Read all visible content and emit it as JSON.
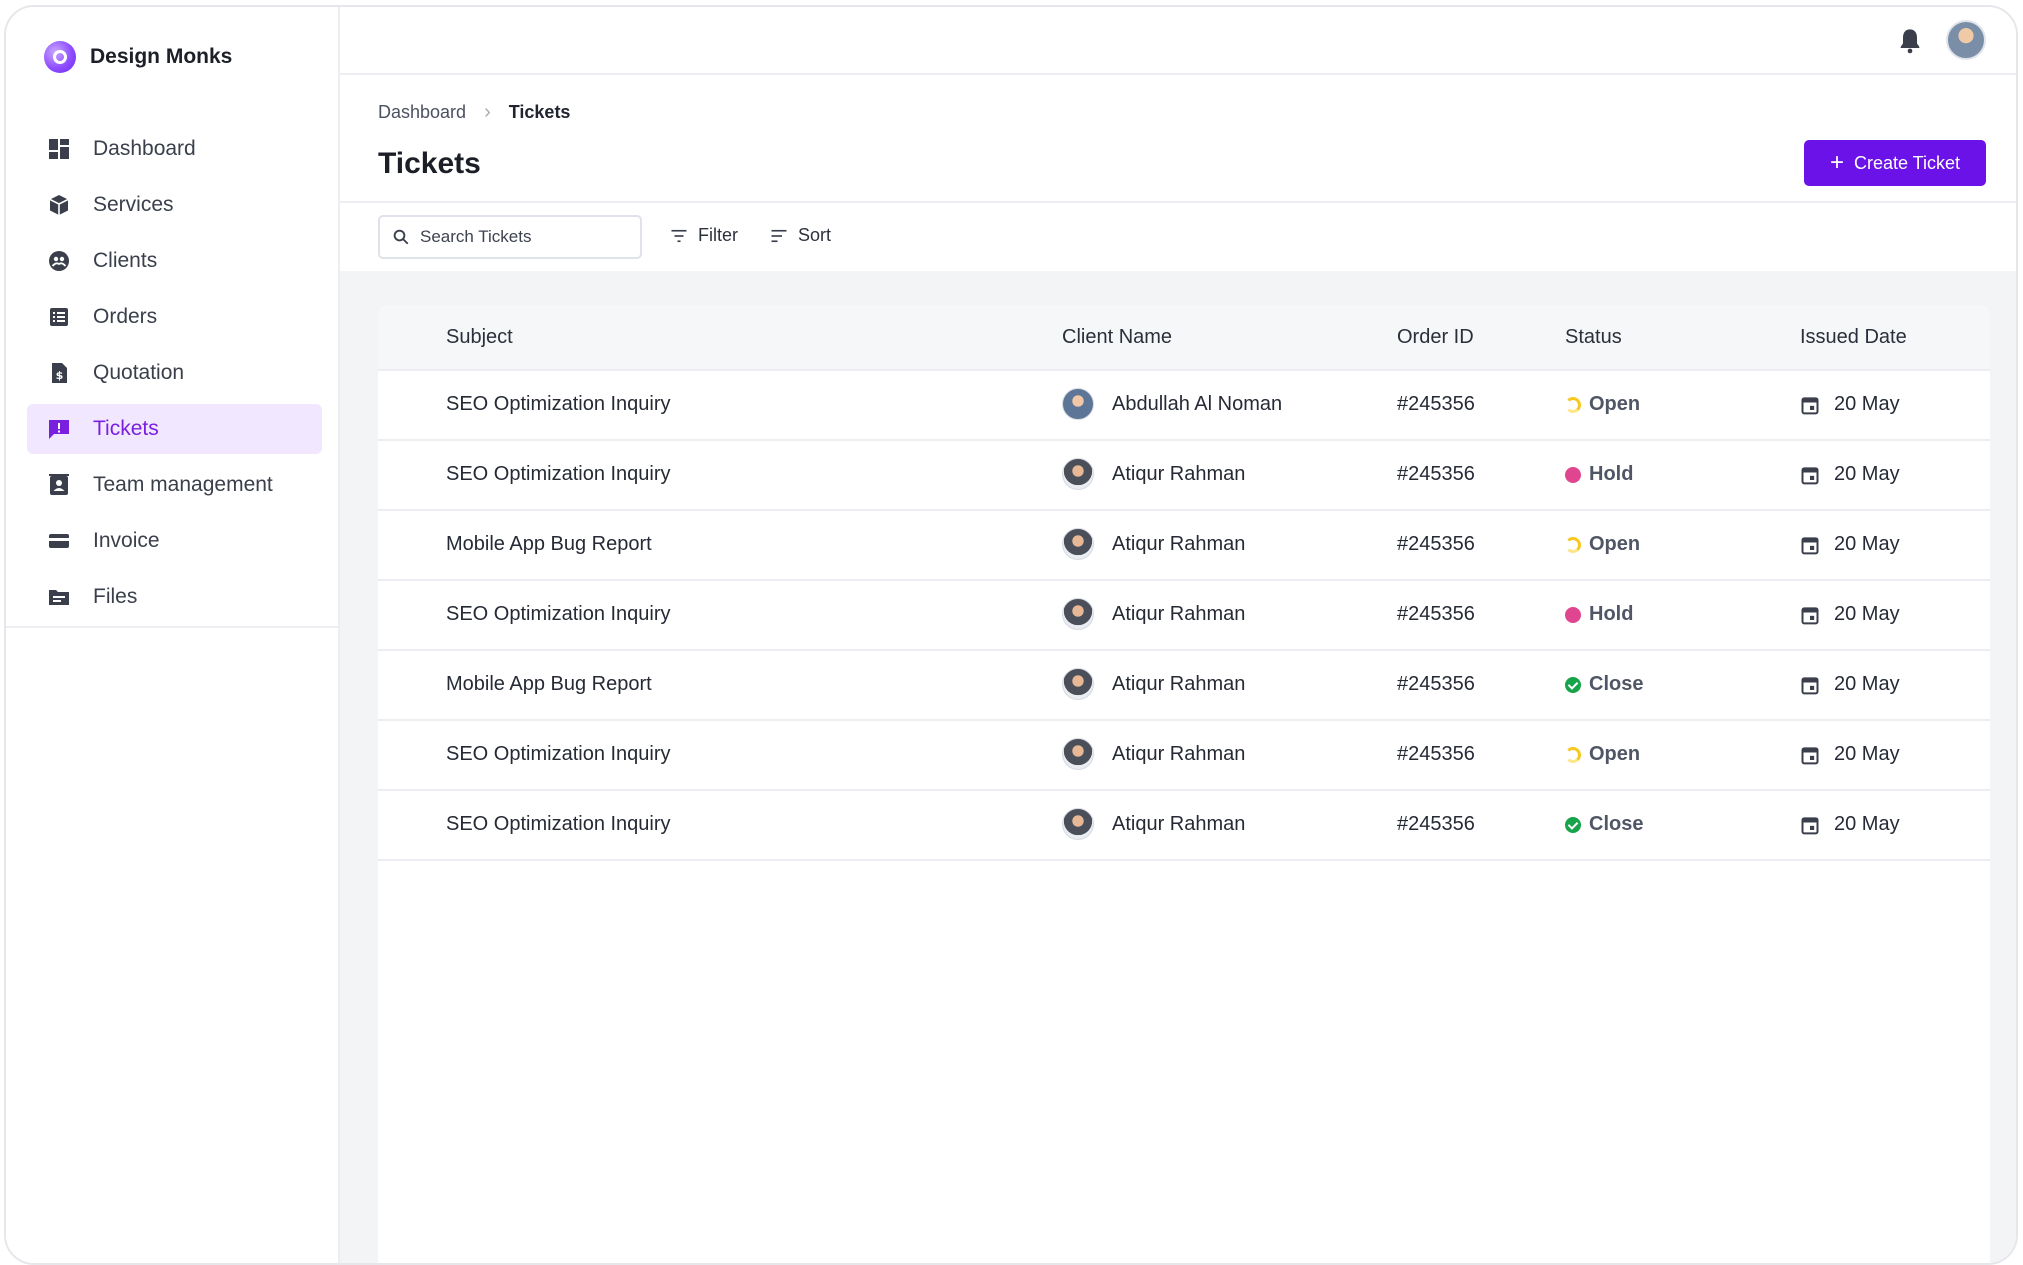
{
  "brand": {
    "name": "Design Monks"
  },
  "sidebar": {
    "items": [
      {
        "label": "Dashboard",
        "icon": "dashboard-icon"
      },
      {
        "label": "Services",
        "icon": "box-icon"
      },
      {
        "label": "Clients",
        "icon": "clients-icon"
      },
      {
        "label": "Orders",
        "icon": "orders-icon"
      },
      {
        "label": "Quotation",
        "icon": "quotation-icon"
      },
      {
        "label": "Tickets",
        "icon": "ticket-icon",
        "active": true
      },
      {
        "label": "Team management",
        "icon": "team-icon"
      },
      {
        "label": "Invoice",
        "icon": "invoice-icon"
      },
      {
        "label": "Files",
        "icon": "folder-icon"
      }
    ]
  },
  "breadcrumb": {
    "parent": "Dashboard",
    "current": "Tickets"
  },
  "page": {
    "title": "Tickets",
    "create_label": "Create Ticket"
  },
  "toolbar": {
    "search_placeholder": "Search Tickets",
    "filter_label": "Filter",
    "sort_label": "Sort"
  },
  "table": {
    "headers": {
      "subject": "Subject",
      "client": "Client Name",
      "order": "Order ID",
      "status": "Status",
      "date": "Issued Date"
    },
    "rows": [
      {
        "subject": "SEO Optimization Inquiry",
        "client": "Abdullah Al Noman",
        "order": "#245356",
        "status": "Open",
        "date": "20 May"
      },
      {
        "subject": "SEO Optimization Inquiry",
        "client": "Atiqur Rahman",
        "order": "#245356",
        "status": "Hold",
        "date": "20 May"
      },
      {
        "subject": "Mobile App Bug Report",
        "client": "Atiqur Rahman",
        "order": "#245356",
        "status": "Open",
        "date": "20 May"
      },
      {
        "subject": "SEO Optimization Inquiry",
        "client": "Atiqur Rahman",
        "order": "#245356",
        "status": "Hold",
        "date": "20 May"
      },
      {
        "subject": "Mobile App Bug Report",
        "client": "Atiqur Rahman",
        "order": "#245356",
        "status": "Close",
        "date": "20 May"
      },
      {
        "subject": "SEO Optimization Inquiry",
        "client": "Atiqur Rahman",
        "order": "#245356",
        "status": "Open",
        "date": "20 May"
      },
      {
        "subject": "SEO Optimization Inquiry",
        "client": "Atiqur Rahman",
        "order": "#245356",
        "status": "Close",
        "date": "20 May"
      }
    ]
  },
  "colors": {
    "accent": "#6a12e8",
    "active_nav_bg": "#f1e8ff",
    "status_open": "#f7c81e",
    "status_hold": "#e0458f",
    "status_close": "#16a34a"
  }
}
